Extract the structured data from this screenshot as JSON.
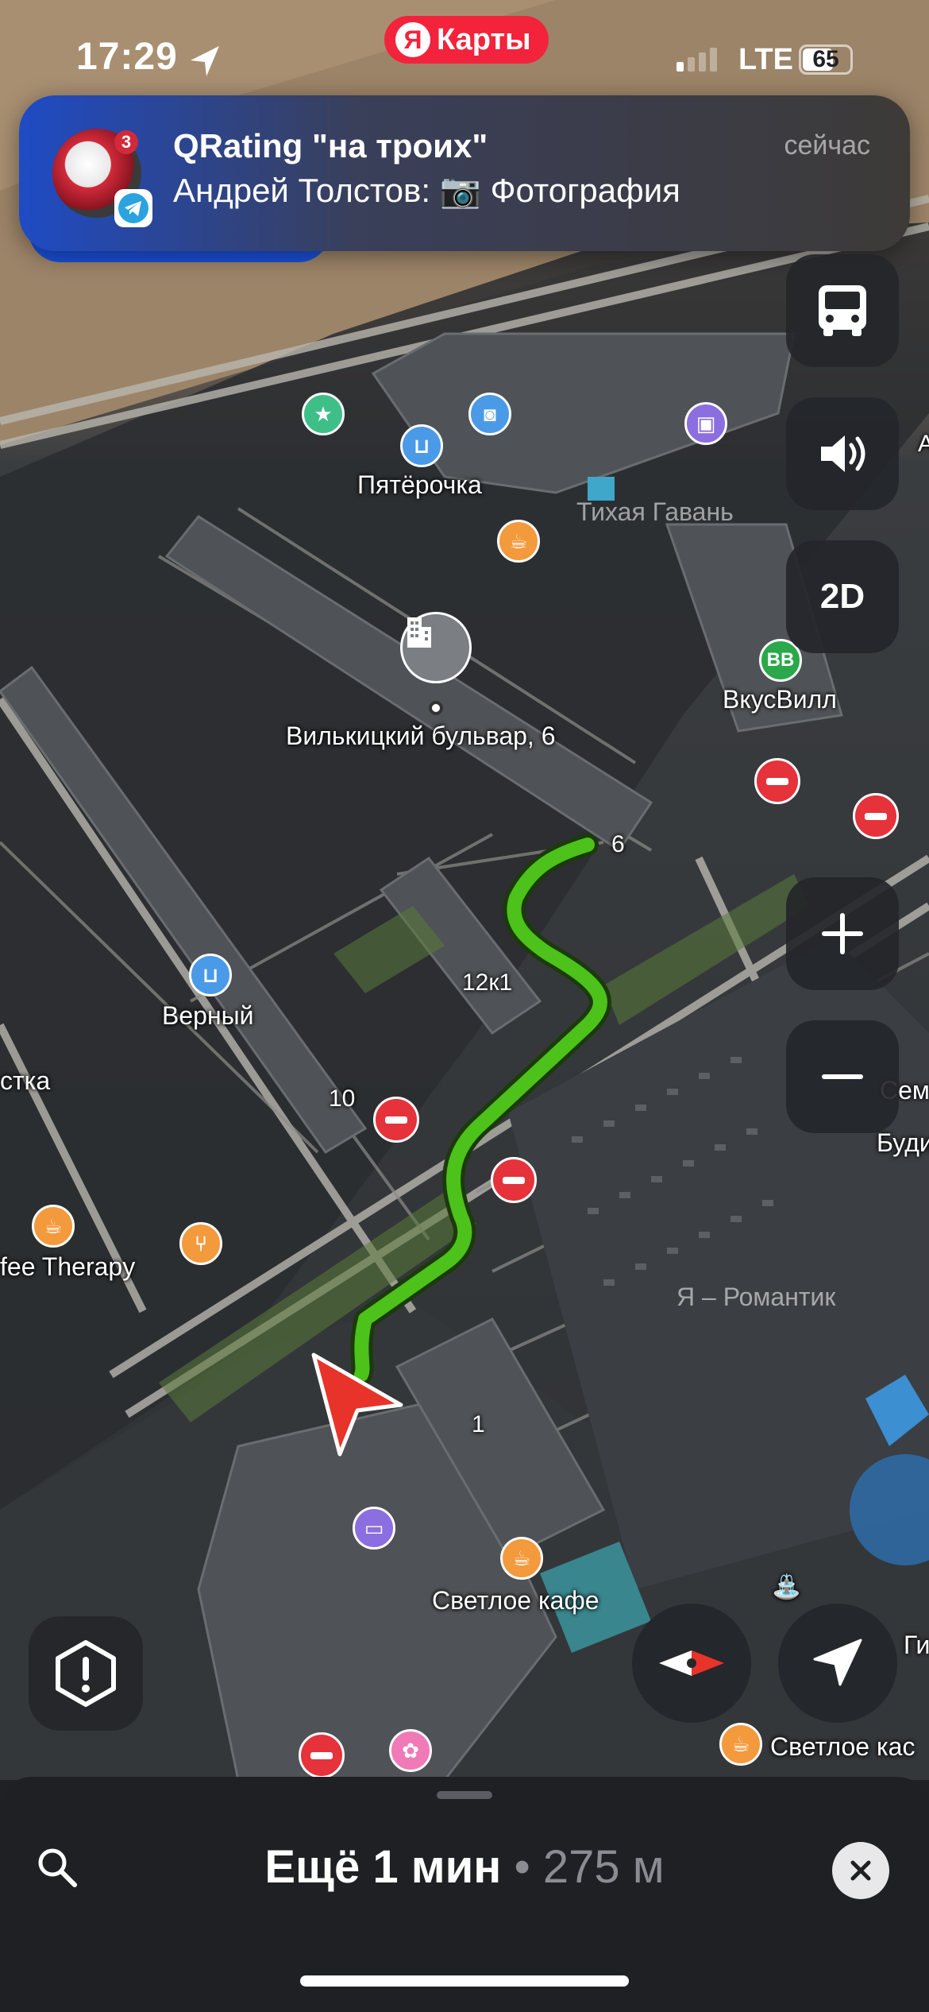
{
  "status_bar": {
    "time": "17:29",
    "network": "LTE",
    "battery": "65",
    "battery_level": 0.65,
    "location_icon": "location-arrow-icon"
  },
  "app_pill": {
    "logo": "Я",
    "label": "Карты",
    "color": "#f2233b"
  },
  "notification": {
    "title": "QRating \"на троих\"",
    "text": "Андрей Толстов: 📷 Фотография",
    "time": "сейчас",
    "avatar_badge": "3",
    "app_icon": "telegram-icon"
  },
  "map": {
    "labels": {
      "pyaterochka": "Пятёрочка",
      "tikhaya_gavan": "Тихая Гавань",
      "vkusvill": "ВкусВилл",
      "vkusvill_badge": "ВВ",
      "address": "Вилькицкий бульвар, 6",
      "house_6": "6",
      "house_12k1": "12к1",
      "house_10": "10",
      "house_1": "1",
      "verny": "Верный",
      "stka": "стка",
      "coffee_therapy": "fee Therapy",
      "romantik": "Я – Романтик",
      "svetloe_kafe": "Светлое кафе",
      "svetloe_kafe_2": "Светлое кас",
      "semishag": "Семишаго",
      "budi": "Буди",
      "gi": "Ги",
      "edge_a": "А"
    },
    "route_color": "#4cc21a"
  },
  "controls": {
    "transport_icon": "bus-icon",
    "sound_icon": "speaker-icon",
    "mode_label": "2D",
    "zoom_in_icon": "plus-icon",
    "zoom_out_icon": "minus-icon",
    "alert_icon": "hexagon-alert-icon",
    "compass_icon": "compass-icon",
    "locate_icon": "navigation-arrow-icon"
  },
  "bottom_panel": {
    "eta": "Ещё 1 мин",
    "separator": "•",
    "distance": "275 м",
    "search_icon": "search-icon",
    "close_icon": "close-icon"
  }
}
